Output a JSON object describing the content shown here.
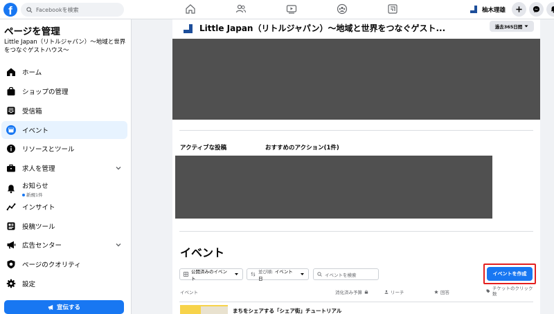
{
  "topbar": {
    "search_placeholder": "Facebookを検索",
    "user_name": "柚木理雄"
  },
  "sidebar": {
    "title": "ページを管理",
    "page_name": "Little Japan（リトルジャパン）〜地域と世界をつなぐゲストハウス〜",
    "items": [
      {
        "label": "ホーム"
      },
      {
        "label": "ショップの管理"
      },
      {
        "label": "受信箱"
      },
      {
        "label": "イベント"
      },
      {
        "label": "リソースとツール"
      },
      {
        "label": "求人を管理"
      },
      {
        "label": "お知らせ",
        "sub": "新規1件"
      },
      {
        "label": "インサイト"
      },
      {
        "label": "投稿ツール"
      },
      {
        "label": "広告センター"
      },
      {
        "label": "ページのクオリティ"
      },
      {
        "label": "設定"
      }
    ],
    "promote_label": "宣伝する"
  },
  "main": {
    "page_title": "Little Japan（リトルジャパン）〜地域と世界をつなぐゲスト...",
    "period_label": "過去365日間",
    "active_posts_label": "アクティブな投稿",
    "recommended_actions_label": "おすすめのアクション(1件)",
    "events_heading": "イベント",
    "filters": {
      "published": "公開済みのイベント",
      "sort_prefix": "並び順:",
      "sort_value": "イベント日",
      "search_placeholder": "イベントを検索"
    },
    "create_event_label": "イベントを作成",
    "table_headers": {
      "event": "イベント",
      "budget": "消化済み予算",
      "reach": "リーチ",
      "replies": "回答",
      "ticket_clicks": "チケットのクリック数"
    },
    "rows": [
      {
        "title": "まちをシェアする「シェア街」チュートリアル"
      }
    ]
  },
  "colors": {
    "brand": "#1877f2",
    "highlight_border": "#e41e1e",
    "active_bg": "#e7f3ff"
  }
}
